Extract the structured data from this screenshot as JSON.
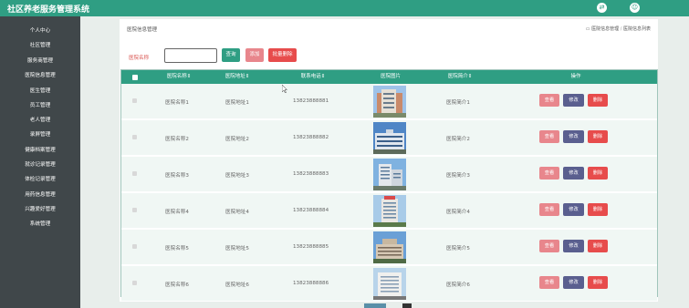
{
  "app": {
    "title": "社区养老服务管理系统"
  },
  "header": {
    "icons": [
      "swap-icon",
      "user-icon"
    ]
  },
  "sidebar": {
    "items": [
      {
        "label": "个人中心"
      },
      {
        "label": "社区管理"
      },
      {
        "label": "服务商管理"
      },
      {
        "label": "医院信息管理"
      },
      {
        "label": "医生管理"
      },
      {
        "label": "员工管理"
      },
      {
        "label": "老人管理"
      },
      {
        "label": "录屏管理"
      },
      {
        "label": "健康档案管理"
      },
      {
        "label": "就诊记录管理"
      },
      {
        "label": "体检记录管理"
      },
      {
        "label": "用药信息管理"
      },
      {
        "label": "兴趣爱好管理"
      },
      {
        "label": "系统管理"
      }
    ]
  },
  "breadcrumb": {
    "title": "医院信息管理",
    "home": "医院信息管理",
    "current": "医院信息列表"
  },
  "search": {
    "label": "医院名称",
    "value": "",
    "query_label": "查询",
    "add_label": "添加",
    "batch_delete_label": "批量删除"
  },
  "table": {
    "columns": [
      "医院名称",
      "医院地址",
      "联系电话",
      "医院图片",
      "医院简介",
      "操作"
    ],
    "rows": [
      {
        "name": "医院名称1",
        "address": "医院地址1",
        "phone": "13823888881",
        "intro": "医院简介1"
      },
      {
        "name": "医院名称2",
        "address": "医院地址2",
        "phone": "13823888882",
        "intro": "医院简介2"
      },
      {
        "name": "医院名称3",
        "address": "医院地址3",
        "phone": "13823888883",
        "intro": "医院简介3"
      },
      {
        "name": "医院名称4",
        "address": "医院地址4",
        "phone": "13823888884",
        "intro": "医院简介4"
      },
      {
        "name": "医院名称5",
        "address": "医院地址5",
        "phone": "13823888885",
        "intro": "医院简介5"
      },
      {
        "name": "医院名称6",
        "address": "医院地址6",
        "phone": "13823888886",
        "intro": "医院简介6"
      }
    ],
    "actions": {
      "view": "查看",
      "edit": "修改",
      "delete": "删除"
    }
  },
  "colors": {
    "accent": "#2f9e83",
    "sidebar": "#40474a",
    "danger": "#e74c4c",
    "pink": "#e8868c",
    "purple": "#5a5f8f"
  }
}
